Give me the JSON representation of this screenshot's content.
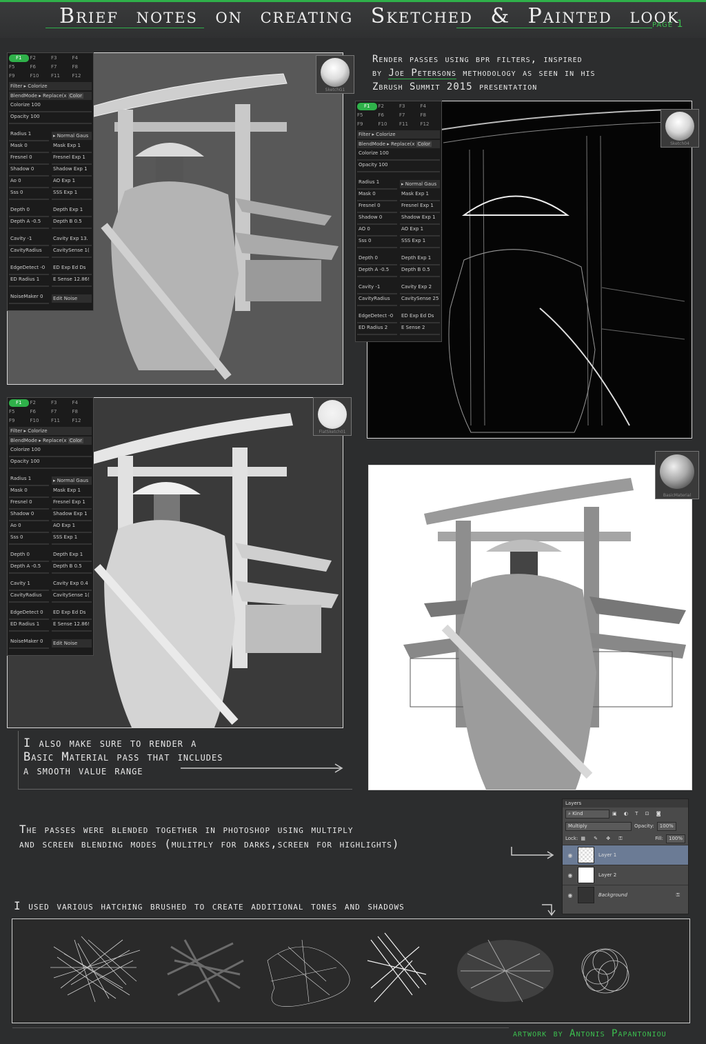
{
  "header": {
    "title": "Brief notes on creating Sketched & Painted look",
    "page_tag": "page 1"
  },
  "intro_note": {
    "line1": "Render passes using bpr filters, inspired",
    "line2_prefix": "by ",
    "line2_name": "Joe Petersons",
    "line2_suffix": " methodology as seen in his",
    "line3": "Zbrush Summit 2015 presentation"
  },
  "zbrush_panels": [
    {
      "fkeys": [
        "F1",
        "F2",
        "F3",
        "F4",
        "F5",
        "F6",
        "F7",
        "F8",
        "F9",
        "F10",
        "F11",
        "F12"
      ],
      "filter": "Filter ▸ Colorize",
      "blendmode": "BlendMode ▸ Replace(x",
      "color_label": "Color",
      "colorize": "Colorize 100",
      "opacity": "Opacity 100",
      "radius": "Radius 1",
      "normal": "▸ Normal Gaus",
      "rows": [
        [
          "Mask 0",
          "Mask Exp 1"
        ],
        [
          "Fresnel 0",
          "Fresnel Exp 1"
        ],
        [
          "Shadow 0",
          "Shadow Exp 1"
        ],
        [
          "Ao 0",
          "AO Exp 1"
        ],
        [
          "Sss 0",
          "SSS Exp 1"
        ]
      ],
      "depth": [
        [
          "Depth 0",
          "Depth Exp 1"
        ],
        [
          "Depth A -0.5",
          "Depth B 0.5"
        ]
      ],
      "cavity": [
        [
          "Cavity -1",
          "Cavity Exp 13."
        ],
        [
          "CavityRadius",
          "CavitySense 1("
        ]
      ],
      "edge": [
        [
          "EdgeDetect -0",
          "ED Exp  Ed Ds"
        ],
        [
          "ED Radius 1",
          "E Sense 12.86!"
        ]
      ],
      "noise": [
        "NoiseMaker 0",
        "Edit Noise"
      ],
      "matcap": "SketchG1"
    },
    {
      "fkeys": [
        "F1",
        "F2",
        "F3",
        "F4",
        "F5",
        "F6",
        "F7",
        "F8",
        "F9",
        "F10",
        "F11",
        "F12"
      ],
      "filter": "Filter ▸ Colorize",
      "blendmode": "BlendMode ▸ Replace(x",
      "color_label": "Color",
      "colorize": "Colorize 100",
      "opacity": "Opacity 100",
      "radius": "Radius 1",
      "normal": "▸ Normal Gaus",
      "rows": [
        [
          "Mask 0",
          "Mask Exp 1"
        ],
        [
          "Fresnel 0",
          "Fresnel Exp 1"
        ],
        [
          "Shadow 0",
          "Shadow Exp 1"
        ],
        [
          "AO 0",
          "AO Exp 1"
        ],
        [
          "Sss 0",
          "SSS Exp 1"
        ]
      ],
      "depth": [
        [
          "Depth 0",
          "Depth Exp 1"
        ],
        [
          "Depth A -0.5",
          "Depth B 0.5"
        ]
      ],
      "cavity": [
        [
          "Cavity -1",
          "Cavity Exp 2"
        ],
        [
          "CavityRadius",
          "CavitySense 25"
        ]
      ],
      "edge": [
        [
          "EdgeDetect -0",
          "ED Exp  Ed Ds"
        ],
        [
          "ED Radius 2",
          "E Sense 2"
        ]
      ],
      "noise": [],
      "matcap": "Sketch04"
    },
    {
      "fkeys": [
        "F1",
        "F2",
        "F3",
        "F4",
        "F5",
        "F6",
        "F7",
        "F8",
        "F9",
        "F10",
        "F11",
        "F12"
      ],
      "filter": "Filter ▸ Colorize",
      "blendmode": "BlendMode ▸ Replace(x",
      "color_label": "Color",
      "colorize": "Colorize 100",
      "opacity": "Opacity 100",
      "radius": "Radius 1",
      "normal": "▸ Normal Gaus",
      "rows": [
        [
          "Mask 0",
          "Mask Exp 1"
        ],
        [
          "Fresnel 0",
          "Fresnel Exp 1"
        ],
        [
          "Shadow 0",
          "Shadow Exp 1"
        ],
        [
          "Ao 0",
          "AO Exp 1"
        ],
        [
          "Sss 0",
          "SSS Exp 1"
        ]
      ],
      "depth": [
        [
          "Depth 0",
          "Depth Exp 1"
        ],
        [
          "Depth A -0.5",
          "Depth B 0.5"
        ]
      ],
      "cavity": [
        [
          "Cavity 1",
          "Cavity Exp 0.4"
        ],
        [
          "CavityRadius",
          "CavitySense 1("
        ]
      ],
      "edge": [
        [
          "EdgeDetect 0",
          "ED Exp  Ed Ds"
        ],
        [
          "ED Radius 1",
          "E Sense 12.86!"
        ]
      ],
      "noise": [
        "NoiseMaker 0",
        "Edit Noise"
      ],
      "matcap": "FlatSketch01"
    }
  ],
  "basic_material_label": "BasicMaterial",
  "material_note": {
    "line1": "I also make sure to render a",
    "line2": "Basic Material pass that includes",
    "line3": "a smooth value range"
  },
  "blend_note": {
    "line1": "The passes were blended together in photoshop using multiply",
    "line2": "and screen blending modes (mulitply for darks,screen for highlights)"
  },
  "layers_panel": {
    "title": "Layers",
    "kind": "⌕ Kind",
    "blend_mode": "Multiply",
    "opacity_label": "Opacity:",
    "opacity_value": "100%",
    "lock_label": "Lock:",
    "fill_label": "Fill:",
    "fill_value": "100%",
    "layers": [
      "Layer 1",
      "Layer 2",
      "Background"
    ]
  },
  "hatch_note": "I used various hatching brushed to create additional tones and shadows",
  "credit": "artwork by Antonis Papantoniou"
}
